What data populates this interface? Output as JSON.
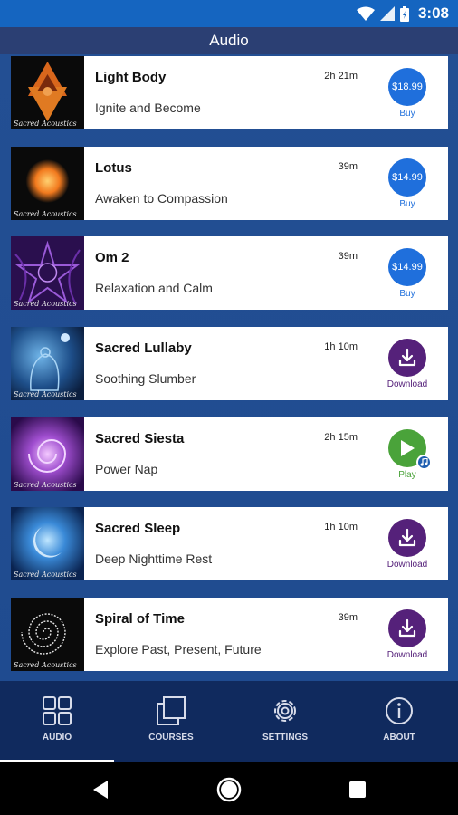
{
  "status_bar": {
    "time": "3:08"
  },
  "app_bar": {
    "title": "Audio"
  },
  "items": [
    {
      "title": "Light Body",
      "subtitle": "Ignite and Become",
      "duration": "2h 21m",
      "action": "buy",
      "price": "$18.99",
      "action_label": "Buy",
      "brand": "Sacred Acoustics"
    },
    {
      "title": "Lotus",
      "subtitle": "Awaken to Compassion",
      "duration": "39m",
      "action": "buy",
      "price": "$14.99",
      "action_label": "Buy",
      "brand": "Sacred Acoustics"
    },
    {
      "title": "Om 2",
      "subtitle": "Relaxation and Calm",
      "duration": "39m",
      "action": "buy",
      "price": "$14.99",
      "action_label": "Buy",
      "brand": "Sacred Acoustics"
    },
    {
      "title": "Sacred Lullaby",
      "subtitle": "Soothing Slumber",
      "duration": "1h 10m",
      "action": "download",
      "action_label": "Download",
      "brand": "Sacred Acoustics"
    },
    {
      "title": "Sacred Siesta",
      "subtitle": "Power Nap",
      "duration": "2h 15m",
      "action": "play",
      "action_label": "Play",
      "brand": "Sacred Acoustics"
    },
    {
      "title": "Sacred Sleep",
      "subtitle": "Deep Nighttime Rest",
      "duration": "1h 10m",
      "action": "download",
      "action_label": "Download",
      "brand": "Sacred Acoustics"
    },
    {
      "title": "Spiral of Time",
      "subtitle": "Explore Past, Present, Future",
      "duration": "39m",
      "action": "download",
      "action_label": "Download",
      "brand": "Sacred Acoustics"
    }
  ],
  "bottom_nav": [
    {
      "label": "AUDIO",
      "icon": "grid-icon",
      "active": true
    },
    {
      "label": "COURSES",
      "icon": "stacked-squares-icon",
      "active": false
    },
    {
      "label": "SETTINGS",
      "icon": "gear-icon",
      "active": false
    },
    {
      "label": "ABOUT",
      "icon": "info-icon",
      "active": false
    }
  ],
  "colors": {
    "status_bar": "#1565c0",
    "app_bar": "#2b3f73",
    "list_background": "#1f4b90",
    "bottom_nav": "#102a5e",
    "buy": "#1f6fdc",
    "download": "#55217a",
    "play": "#4aa33a"
  }
}
